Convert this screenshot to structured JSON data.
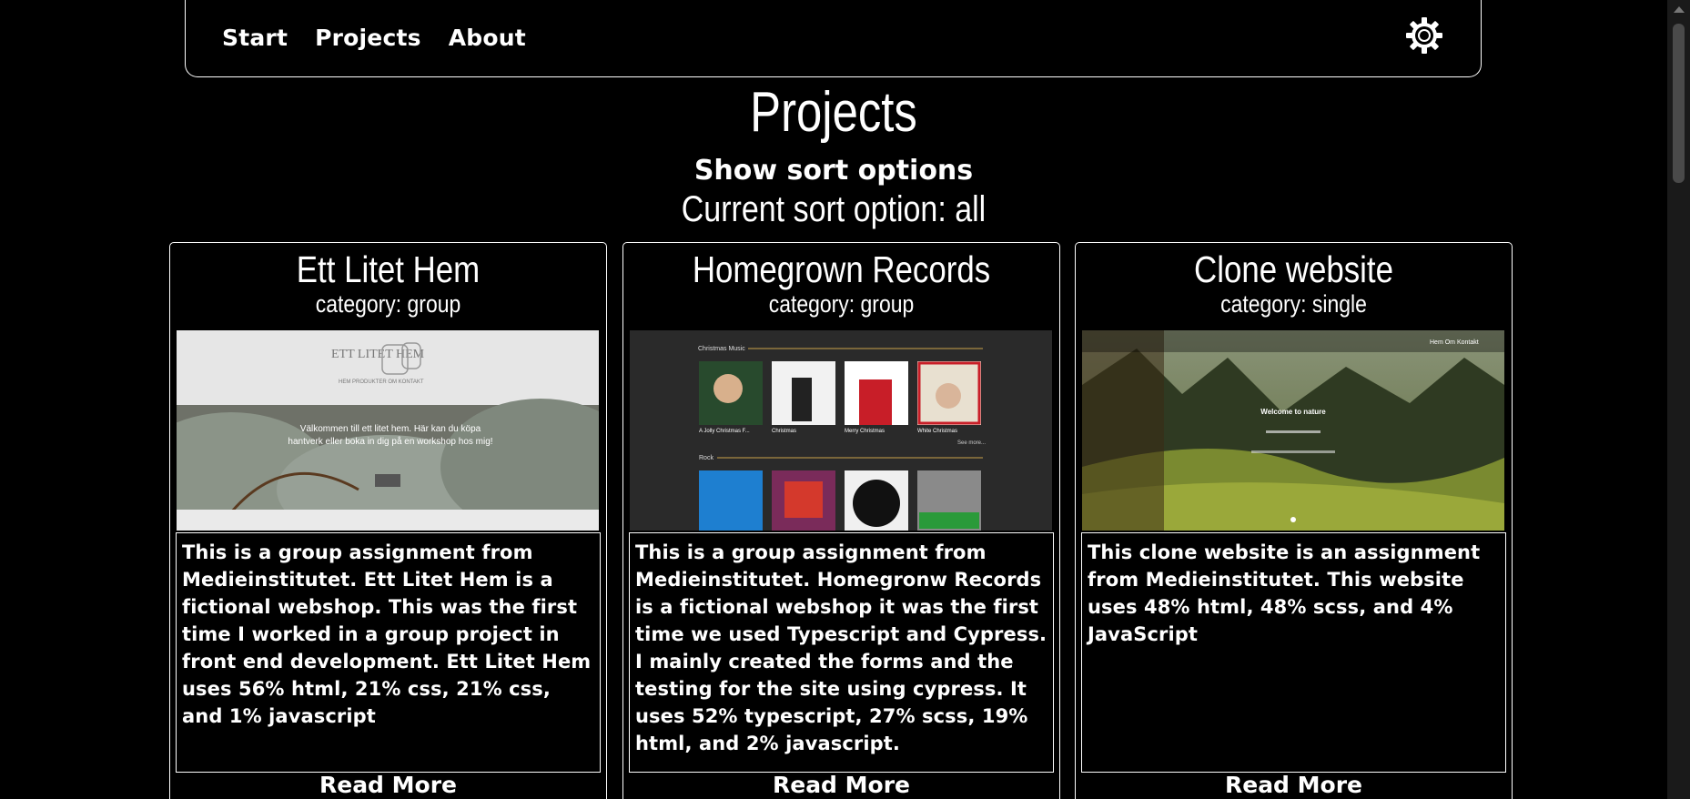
{
  "nav": {
    "links": [
      "Start",
      "Projects",
      "About"
    ],
    "settings_icon": "gear-icon"
  },
  "page": {
    "title": "Projects",
    "sort_toggle": "Show sort options",
    "sort_current": "Current sort option: all"
  },
  "cards": [
    {
      "title": "Ett Litet Hem",
      "category": "category: group",
      "image": {
        "logo_text": "ETT LITET HEM",
        "menu_text": "HEM  PRODUKTER  OM  KONTAKT",
        "hero_text": "Välkommen till ett litet hem. Här kan du köpa hantverk eller boka in dig på en workshop hos mig!"
      },
      "description": "This is a group assignment from Medieinstitutet. Ett Litet Hem is a fictional webshop. This was the first time I worked in a group project in front end development. Ett Litet Hem uses 56% html, 21% css, 21% css, and 1% javascript",
      "read_more": "Read More"
    },
    {
      "title": "Homegrown Records",
      "category": "category: group",
      "image": {
        "section_christmas": "Christmas Music",
        "section_rock": "Rock",
        "see_more": "See more...",
        "albums": [
          "A Jolly Christmas F...",
          "Christmas",
          "Merry Christmas",
          "White Christmas"
        ]
      },
      "description": "This is a group assignment from Medieinstitutet. Homegronw Records is a fictional webshop it was the first time we used Typescript and Cypress. I mainly created the forms and the testing for the site using cypress. It uses 52% typescript, 27% scss, 19% html, and 2% javascript.",
      "read_more": "Read More"
    },
    {
      "title": "Clone website",
      "category": "category: single",
      "image": {
        "nav_text": "Hem   Om   Kontakt",
        "hero_text": "Welcome to nature"
      },
      "description": "This clone website is an assignment from Medieinstitutet. This website uses 48% html, 48% scss, and 4% JavaScript",
      "read_more": "Read More"
    }
  ]
}
